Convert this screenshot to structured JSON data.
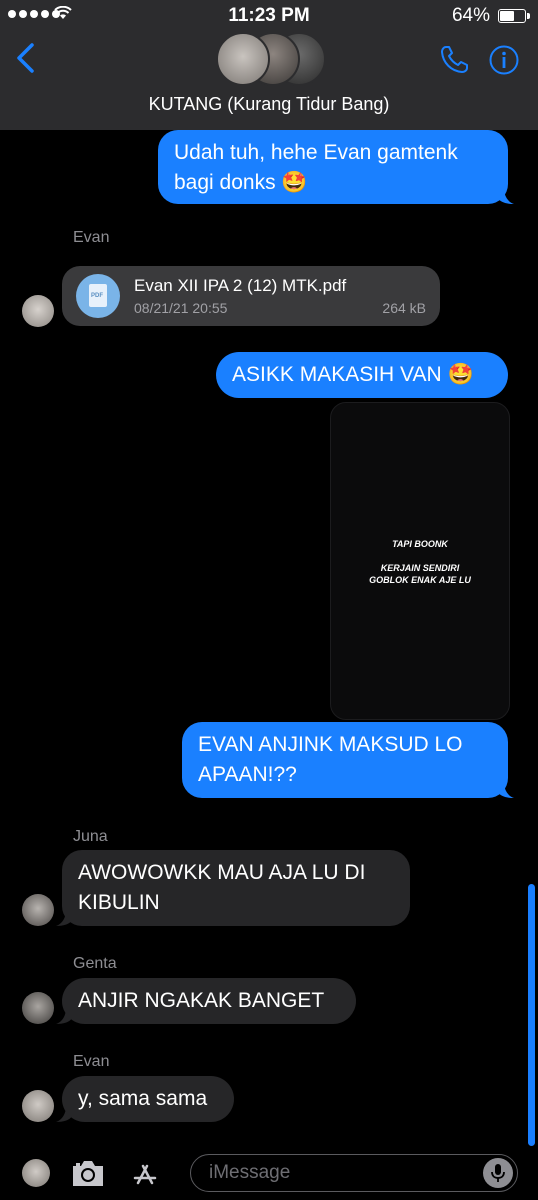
{
  "status_bar": {
    "time": "11:23 PM",
    "battery_percent": "64%",
    "battery_level": 0.64,
    "signal_bars": 5
  },
  "header": {
    "title": "KUTANG (Kurang Tidur Bang)",
    "back_icon": "chevron-left-icon",
    "call_icon": "phone-icon",
    "info_icon": "info-icon"
  },
  "messages": [
    {
      "direction": "outgoing",
      "text": "Udah tuh, hehe Evan gamtenk bagi donks 🤩"
    },
    {
      "direction": "incoming",
      "sender": "Evan",
      "type": "file",
      "file": {
        "name": "Evan XII IPA 2 (12) MTK.pdf",
        "date": "08/21/21 20:55",
        "size": "264 kB",
        "icon_label": "PDF"
      }
    },
    {
      "direction": "outgoing",
      "text": "ASIKK MAKASIH VAN 🤩"
    },
    {
      "direction": "outgoing",
      "type": "image",
      "image_text": {
        "line1": "TAPI BOONK",
        "line2": "KERJAIN SENDIRI",
        "line3": "GOBLOK ENAK AJE LU"
      }
    },
    {
      "direction": "outgoing",
      "text": "EVAN ANJINK MAKSUD LO APAAN!??"
    },
    {
      "direction": "incoming",
      "sender": "Juna",
      "text": "AWOWOWKK MAU AJA LU DI KIBULIN"
    },
    {
      "direction": "incoming",
      "sender": "Genta",
      "text": "ANJIR NGAKAK BANGET"
    },
    {
      "direction": "incoming",
      "sender": "Evan",
      "text": "y, sama sama"
    }
  ],
  "input_bar": {
    "placeholder": "iMessage",
    "camera_icon": "camera-icon",
    "apps_icon": "app-store-icon",
    "mic_icon": "microphone-icon"
  },
  "colors": {
    "outgoing_bubble": "#1a80ff",
    "incoming_bubble": "#262628",
    "background": "#000000",
    "header": "#2c2c2e",
    "accent": "#1a80ff"
  }
}
